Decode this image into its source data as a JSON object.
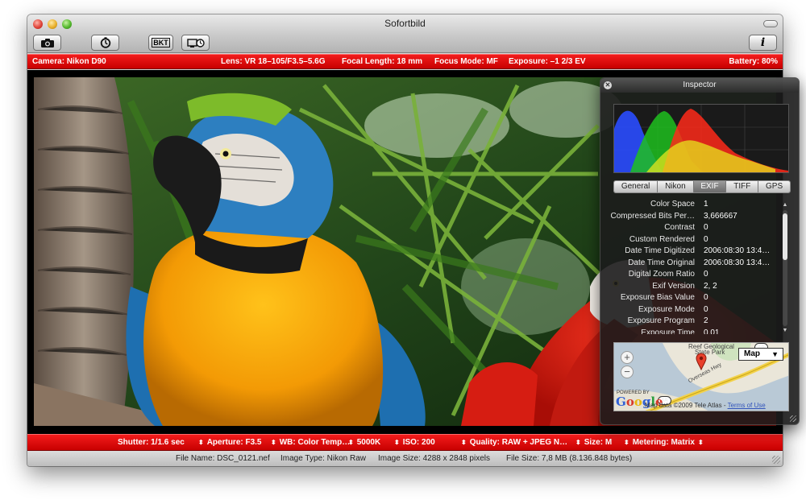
{
  "window": {
    "title": "Sofortbild"
  },
  "toolbar": {
    "capture_icon": "camera-icon",
    "timer_icon": "self-timer-icon",
    "bracketing_label": "BKT",
    "display_icon": "display-clock-icon",
    "info_label": "i"
  },
  "infobar": {
    "camera": "Camera: Nikon D90",
    "lens": "Lens: VR 18–105/F3.5–5.6G",
    "focal_length": "Focal Length: 18 mm",
    "focus_mode": "Focus Mode: MF",
    "exposure": "Exposure: –1 2/3 EV",
    "battery": "Battery: 80%"
  },
  "controls": {
    "shutter": "Shutter: 1/1.6 sec",
    "aperture": "Aperture: F3.5",
    "white_balance": "WB: Color Temp…",
    "color_temp": "5000K",
    "iso": "ISO: 200",
    "quality": "Quality: RAW + JPEG N…",
    "size": "Size: M",
    "metering": "Metering: Matrix"
  },
  "status": {
    "file_name": "File Name: DSC_0121.nef",
    "image_type": "Image Type: Nikon Raw",
    "image_size": "Image Size: 4288 x 2848 pixels",
    "file_size": "File Size: 7,8 MB (8.136.848 bytes)"
  },
  "inspector": {
    "title": "Inspector",
    "close_glyph": "✕",
    "tabs": [
      "General",
      "Nikon",
      "EXIF",
      "TIFF",
      "GPS"
    ],
    "active_tab": "EXIF",
    "exif_rows": [
      {
        "key": "Color Space",
        "value": "1"
      },
      {
        "key": "Compressed Bits Per…",
        "value": "3,666667"
      },
      {
        "key": "Contrast",
        "value": "0"
      },
      {
        "key": "Custom Rendered",
        "value": "0"
      },
      {
        "key": "Date Time Digitized",
        "value": "2006:08:30 13:4…"
      },
      {
        "key": "Date Time Original",
        "value": "2006:08:30 13:4…"
      },
      {
        "key": "Digital Zoom Ratio",
        "value": "0"
      },
      {
        "key": "Exif Version",
        "value": "2, 2"
      },
      {
        "key": "Exposure Bias Value",
        "value": "0"
      },
      {
        "key": "Exposure Mode",
        "value": "0"
      },
      {
        "key": "Exposure Program",
        "value": "2"
      },
      {
        "key": "Exposure Time",
        "value": "0,01"
      }
    ],
    "scroll_position": 0.05,
    "map": {
      "zoom_in": "+",
      "zoom_out": "−",
      "type": "Map",
      "type_arrow": "▼",
      "label_park_1": "Reef Geological",
      "label_park_2": "State Park",
      "label_road": "Overseas Hwy",
      "badge_top": "4A",
      "badge_bottom": "4A",
      "powered_by": "POWERED BY",
      "google": "Google",
      "credit": "Map data ©2009 Tele Atlas - ",
      "terms": "Terms of Use"
    }
  },
  "colors": {
    "bar_red": "#e00000",
    "hud_background": "#1c1c1c",
    "histogram": [
      "#2a4cff",
      "#1fbf1f",
      "#ff2a1a",
      "#e6e61e"
    ]
  }
}
